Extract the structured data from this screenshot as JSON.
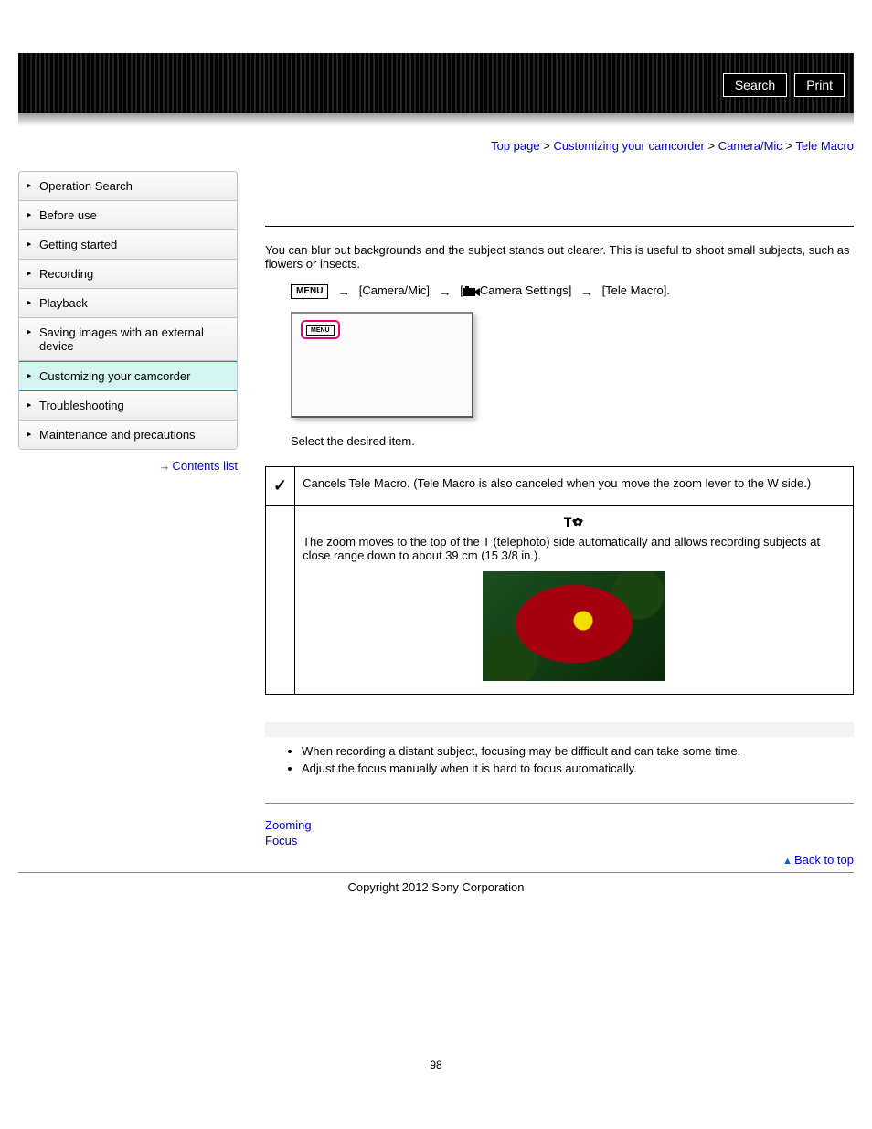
{
  "header": {
    "search_label": "Search",
    "print_label": "Print"
  },
  "breadcrumb": {
    "items": [
      "Top page",
      "Customizing your camcorder",
      "Camera/Mic"
    ],
    "current": "Tele Macro",
    "sep": ">"
  },
  "sidebar": {
    "items": [
      {
        "label": "Operation Search",
        "active": false
      },
      {
        "label": "Before use",
        "active": false
      },
      {
        "label": "Getting started",
        "active": false
      },
      {
        "label": "Recording",
        "active": false
      },
      {
        "label": "Playback",
        "active": false
      },
      {
        "label": "Saving images with an external device",
        "active": false
      },
      {
        "label": "Customizing your camcorder",
        "active": true
      },
      {
        "label": "Troubleshooting",
        "active": false
      },
      {
        "label": "Maintenance and precautions",
        "active": false
      }
    ],
    "contents_list": "Contents list"
  },
  "content": {
    "intro": "You can blur out backgrounds and the subject stands out clearer. This is useful to shoot small subjects, such as flowers or insects.",
    "menu_label": "MENU",
    "path1": "[Camera/Mic]",
    "path2_pre": "[",
    "path2_post": "Camera Settings]",
    "path3": "[Tele Macro].",
    "select_line": "Select the desired item.",
    "options": [
      {
        "icon": "check",
        "text": "Cancels Tele Macro. (Tele Macro is also canceled when you move the zoom lever to the W side.)"
      },
      {
        "icon": "tele",
        "tele_icon_text": "T",
        "text": "The zoom moves to the top of the T (telephoto) side automatically and allows recording subjects at close range down to about 39 cm (15 3/8 in.)."
      }
    ],
    "notes": [
      "When recording a distant subject, focusing may be difficult and can take some time.",
      "Adjust the focus manually when it is hard to focus automatically."
    ],
    "related": {
      "links": [
        "Zooming",
        "Focus"
      ]
    },
    "back_to_top": "Back to top"
  },
  "footer": {
    "copyright": "Copyright 2012 Sony Corporation",
    "page_number": "98"
  }
}
